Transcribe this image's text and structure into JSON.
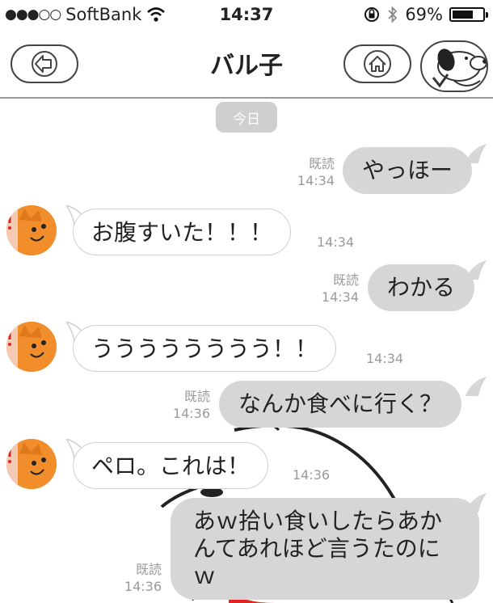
{
  "status": {
    "carrier": "SoftBank",
    "signal_dots": "●●●○○",
    "time": "14:37",
    "battery": "69%",
    "battery_level": 0.69
  },
  "nav": {
    "title": "バル子"
  },
  "chat": {
    "date_label": "今日",
    "messages": [
      {
        "side": "out",
        "text": "やっほー",
        "read": "既読",
        "time": "14:34"
      },
      {
        "side": "in",
        "text": "お腹すいた！！！",
        "time": "14:34"
      },
      {
        "side": "out",
        "text": "わかる",
        "read": "既読",
        "time": "14:34"
      },
      {
        "side": "in",
        "text": "うううううううう！！",
        "time": "14:34"
      },
      {
        "side": "out",
        "text": "なんか食べに行く？",
        "read": "既読",
        "time": "14:36"
      },
      {
        "side": "in",
        "text": "ペロ。これは！",
        "time": "14:36"
      },
      {
        "side": "out",
        "text": "あｗ拾い食いしたらあかんてあれほど言うたのにｗ",
        "read": "既読",
        "time": "14:36"
      }
    ]
  },
  "colors": {
    "out_bubble": "#d6d6d6",
    "in_bubble": "#ffffff",
    "meta_text": "#9a9a9a",
    "avatar_orange": "#f18d2a"
  }
}
